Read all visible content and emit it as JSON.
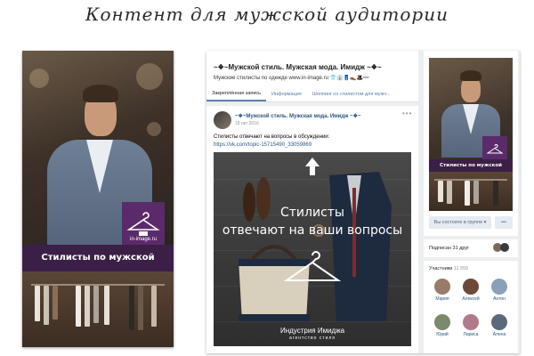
{
  "headline": "Контент для мужской аудитории",
  "promo": {
    "band_text": "Стилисты по мужской одежде",
    "emblem_domain": "in-image.ru"
  },
  "vk": {
    "community_name": "~❖~Мужской стиль. Мужская мода. Имидж ~❖~",
    "status": "Мужские стилисты по одежде www.in-image.ru 👕👔👖👞🎩👓",
    "tabs": [
      "Закреплённая запись",
      "Информация",
      "Шоппинг со стилистом для мужч..."
    ],
    "post": {
      "author": "~❖~Мужской стиль. Мужская мода. Имидж ~❖~",
      "date": "18 окт 2016",
      "text": "Стилисты отвечают на вопросы в обсуждении:",
      "link": "https://vk.com/topic-15715490_33059869",
      "image_line1": "Стилисты",
      "image_line2": "отвечают на ваши вопросы",
      "image_footer_line1": "Индустрия Имиджа",
      "image_footer_line2": "агентство стиля"
    },
    "sidebar": {
      "subscribe_button": "Вы состоите в группе ▾",
      "more_button": "•••",
      "friends_text": "Подписан 31 друг",
      "members_label": "Участники",
      "members_count": "11 555",
      "members": [
        {
          "name": "Мария",
          "color": "#9a7b6a"
        },
        {
          "name": "Алексей",
          "color": "#6b4a3a"
        },
        {
          "name": "Антон",
          "color": "#8aa0b8"
        },
        {
          "name": "Юрий",
          "color": "#7a8a6a"
        },
        {
          "name": "Лариса",
          "color": "#b07a8a"
        },
        {
          "name": "Алена",
          "color": "#5a6a7a"
        }
      ]
    }
  }
}
